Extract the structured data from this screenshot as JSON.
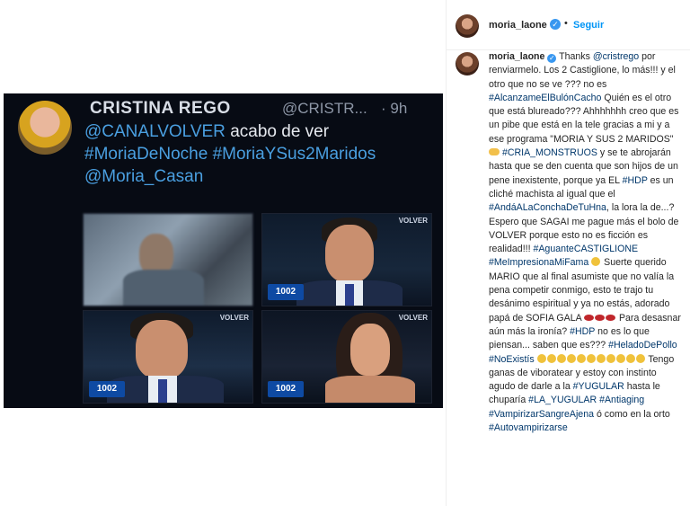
{
  "post": {
    "author": "moria_laone",
    "follow_label": "Seguir",
    "separator": "•"
  },
  "tweet": {
    "name": "CRISTINA REGO",
    "handle": "@CRISTR...",
    "time": "· 9h",
    "mention": "@CANALVOLVER",
    "text": " acabo de ver",
    "tag1": "#MoriaDeNoche",
    "tag2": "#MoriaYSus2Maridos",
    "mention2": "@Moria_Casan"
  },
  "stills": {
    "channel": "VOLVER",
    "bug": "1002"
  },
  "caption": {
    "username": "moria_laone",
    "t1": " Thanks ",
    "m1": "@cristrego",
    "t2": " por renviarmelo. Los 2 Castiglione, lo más!!! y el otro que no se ve ??? no es ",
    "h1": "#AlcanzameElBulónCacho",
    "t3": " Quién es el otro que está blureado??? Ahhhhhhh creo que es un pibe que está en la tele gracias a mi y a ese programa \"MORIA Y SUS 2 MARIDOS\" ",
    "h2": "#CRIA_MONSTRUOS",
    "t4": " y se te abrojarán hasta que se den cuenta que son hijos de un pene inexistente, porque ya EL ",
    "h3": "#HDP",
    "t5": " es un cliché machista al igual que el ",
    "h4": "#AndáALaConchaDeTuHna",
    "t6": ", la lora la de...? Espero que SAGAI me pague más el bolo de VOLVER porque esto no es ficción es realidad!!! ",
    "h5": "#AguanteCASTIGLIONE",
    "h6": "#MeImpresionaMiFama",
    "t7": " Suerte querido MARIO que al final asumiste que no valía la pena competir conmigo, esto te trajo tu desánimo espiritual y ya no estás, adorado papá de SOFIA GALA ",
    "t8": " Para desasnar aún más la ironía? ",
    "h7": "#HDP",
    "t9": " no es lo que piensan... saben que es??? ",
    "h8": "#HeladoDePollo",
    "h9": "#NoExistís",
    "t10": " Tengo ganas de viboratear y estoy con instinto agudo de darle a la ",
    "h10": "#YUGULAR",
    "t11": " hasta le chuparía ",
    "h11": "#LA_YUGULAR",
    "h12": "#Antiaging",
    "h13": "#VampirizarSangreAjena",
    "t12": " ó como en la orto ",
    "h14": "#Autovampirizarse"
  },
  "colors": {
    "link": "#0095f6",
    "hashtag": "#00376b",
    "verified": "#3897f0",
    "tweet_bg": "#070b14"
  }
}
